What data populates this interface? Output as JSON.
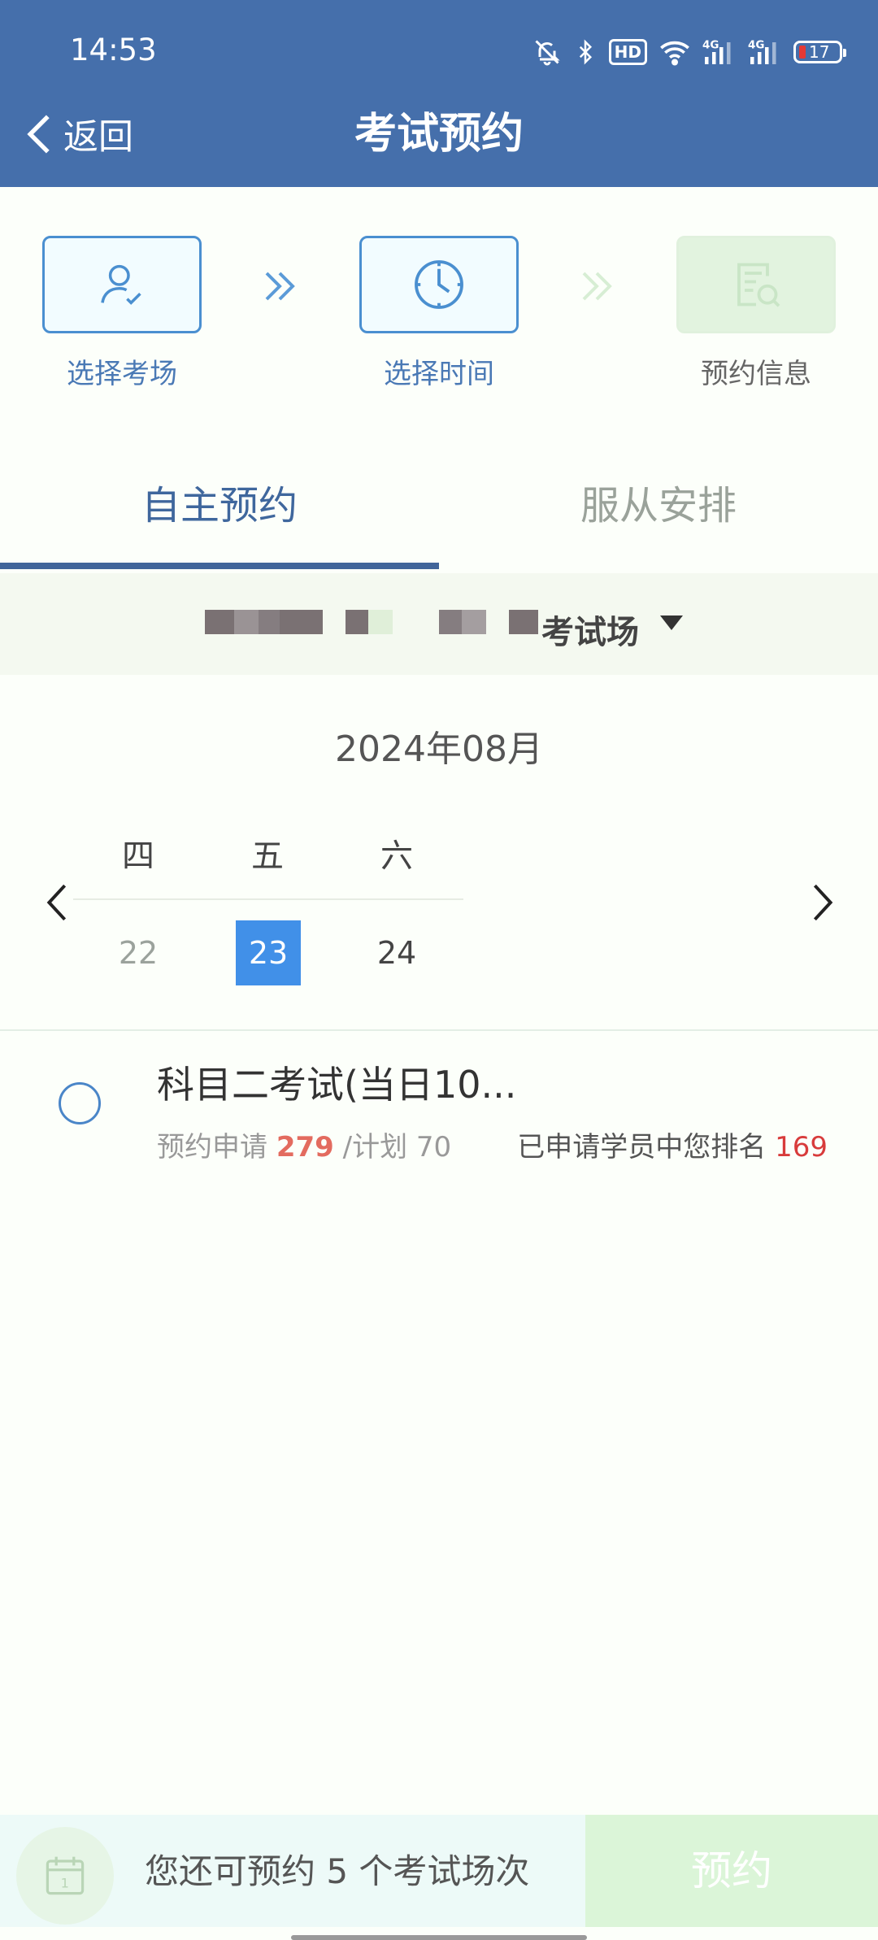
{
  "status_bar": {
    "time": "14:53",
    "hd_label": "HD",
    "net1": "4G",
    "net2": "4G",
    "battery": "17"
  },
  "header": {
    "back_label": "返回",
    "title": "考试预约"
  },
  "steps": [
    {
      "label": "选择考场",
      "icon": "user-check-icon",
      "state": "done"
    },
    {
      "label": "选择时间",
      "icon": "clock-icon",
      "state": "current"
    },
    {
      "label": "预约信息",
      "icon": "document-search-icon",
      "state": "pending"
    }
  ],
  "tabs": {
    "active": "自主预约",
    "inactive": "服从安排"
  },
  "location": {
    "suffix": "考试场"
  },
  "calendar": {
    "month": "2024年08月",
    "weekdays": [
      "四",
      "五",
      "六"
    ],
    "days": [
      "22",
      "23",
      "24"
    ],
    "selected_day": "23"
  },
  "session": {
    "title": "科目二考试(当日10...",
    "applied_label": "预约申请",
    "applied_count": "279",
    "plan_label": "/计划",
    "plan_count": "70",
    "rank_label": "已申请学员中您排名",
    "rank_value": "169"
  },
  "footer": {
    "remaining_text": "您还可预约 5 个考试场次",
    "calendar_day": "1",
    "book_label": "预约"
  },
  "colors": {
    "header_bg": "#456fab",
    "accent_blue": "#4190e8",
    "orange": "#e36b5f",
    "red": "#d83b3b",
    "book_btn": "#dbf5d8"
  }
}
